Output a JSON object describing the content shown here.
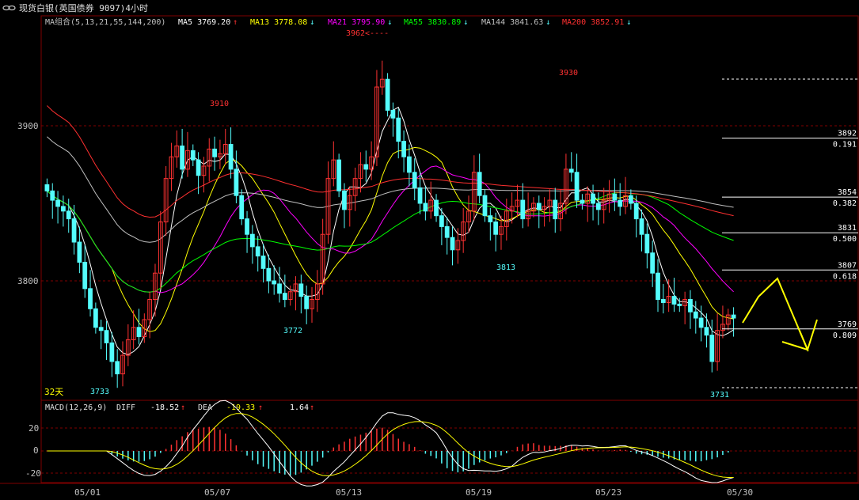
{
  "window": {
    "title": "现货白银(英国债券 9097)4小时",
    "icon": "chain-link-icon"
  },
  "ma_legend": {
    "label": "MA组合(5,13,21,55,144,200)",
    "items": [
      {
        "name": "MA5",
        "value": "3769.20",
        "arrow": "↑",
        "color": "#ffffff"
      },
      {
        "name": "MA13",
        "value": "3778.08",
        "arrow": "↓",
        "color": "#ffff00"
      },
      {
        "name": "MA21",
        "value": "3795.90",
        "arrow": "↓",
        "color": "#ff00ff"
      },
      {
        "name": "MA55",
        "value": "3830.89",
        "arrow": "↓",
        "color": "#00ff00"
      },
      {
        "name": "MA144",
        "value": "3841.63",
        "arrow": "↓",
        "color": "#c0c0c0"
      },
      {
        "name": "MA200",
        "value": "3852.91",
        "arrow": "↓",
        "color": "#ff3030"
      }
    ]
  },
  "price_axis": {
    "labels": [
      "3900",
      "3800"
    ]
  },
  "period_label": "32天",
  "annotations": {
    "highs": [
      "3962",
      "3930",
      "3910"
    ],
    "lows": [
      "3733",
      "3772",
      "3813",
      "3731"
    ],
    "high_arrow": "<----"
  },
  "fib_levels": [
    {
      "price": "3892",
      "ratio": "0.191"
    },
    {
      "price": "3854",
      "ratio": "0.382"
    },
    {
      "price": "3831",
      "ratio": "0.500"
    },
    {
      "price": "3807",
      "ratio": "0.618"
    },
    {
      "price": "3769",
      "ratio": "0.809"
    }
  ],
  "macd_legend": {
    "label": "MACD(12,26,9)",
    "diff_label": "DIFF",
    "diff_value": "-18.52",
    "diff_arrow": "↑",
    "dea_label": "DEA",
    "dea_value": "-19.33",
    "dea_arrow": "↑",
    "macd_value": "1.64",
    "macd_arrow": "↑"
  },
  "macd_axis": {
    "labels": [
      "20",
      "0",
      "-20"
    ]
  },
  "date_axis": {
    "labels": [
      "05/01",
      "05/07",
      "05/13",
      "05/19",
      "05/23",
      "05/30"
    ]
  },
  "colors": {
    "up": "#ff3232",
    "down": "#54fcfc",
    "grid": "#800000",
    "axis_text": "#c0c0c0",
    "projection": "#ffff00"
  },
  "chart_data": {
    "type": "candlestick",
    "timeframe": "4H",
    "price_axis_reference": [
      3800,
      3900
    ],
    "x": [
      "05/01",
      "05/07",
      "05/13",
      "05/19",
      "05/23",
      "05/30"
    ],
    "extremes": [
      {
        "label": "3733",
        "value": 3733,
        "kind": "low"
      },
      {
        "label": "3910",
        "value": 3910,
        "kind": "high"
      },
      {
        "label": "3772",
        "value": 3772,
        "kind": "low"
      },
      {
        "label": "3962",
        "value": 3962,
        "kind": "high"
      },
      {
        "label": "3813",
        "value": 3813,
        "kind": "low"
      },
      {
        "label": "3930",
        "value": 3930,
        "kind": "high"
      },
      {
        "label": "3731",
        "value": 3731,
        "kind": "low"
      }
    ],
    "closes": [
      3858,
      3852,
      3848,
      3845,
      3840,
      3825,
      3812,
      3795,
      3782,
      3770,
      3768,
      3760,
      3748,
      3740,
      3752,
      3762,
      3770,
      3764,
      3775,
      3788,
      3805,
      3838,
      3866,
      3880,
      3887,
      3872,
      3884,
      3878,
      3868,
      3874,
      3885,
      3880,
      3882,
      3888,
      3872,
      3855,
      3840,
      3830,
      3822,
      3816,
      3808,
      3800,
      3798,
      3792,
      3788,
      3793,
      3798,
      3790,
      3782,
      3788,
      3798,
      3830,
      3866,
      3878,
      3858,
      3846,
      3855,
      3866,
      3875,
      3872,
      3880,
      3925,
      3930,
      3910,
      3905,
      3890,
      3880,
      3870,
      3860,
      3850,
      3845,
      3852,
      3842,
      3835,
      3828,
      3820,
      3826,
      3838,
      3845,
      3870,
      3855,
      3842,
      3838,
      3830,
      3835,
      3845,
      3848,
      3852,
      3840,
      3845,
      3850,
      3846,
      3848,
      3852,
      3840,
      3850,
      3872,
      3870,
      3852,
      3850,
      3856,
      3850,
      3846,
      3852,
      3856,
      3852,
      3848,
      3855,
      3850,
      3840,
      3830,
      3818,
      3805,
      3788,
      3786,
      3790,
      3785,
      3784,
      3788,
      3780,
      3776,
      3770,
      3765,
      3748,
      3768,
      3772,
      3778,
      3776
    ],
    "ma_series": [
      {
        "name": "MA5",
        "color": "#ffffff",
        "last": 3769.2
      },
      {
        "name": "MA13",
        "color": "#ffff00",
        "last": 3778.08
      },
      {
        "name": "MA21",
        "color": "#ff00ff",
        "last": 3795.9
      },
      {
        "name": "MA55",
        "color": "#00ff00",
        "last": 3830.89
      },
      {
        "name": "MA144",
        "color": "#c0c0c0",
        "last": 3841.63
      },
      {
        "name": "MA200",
        "color": "#ff3030",
        "last": 3852.91
      }
    ],
    "fibonacci": [
      {
        "ratio": 0.191,
        "price": 3892
      },
      {
        "ratio": 0.382,
        "price": 3854
      },
      {
        "ratio": 0.5,
        "price": 3831
      },
      {
        "ratio": 0.618,
        "price": 3807
      },
      {
        "ratio": 0.809,
        "price": 3769
      }
    ],
    "projection_path": [
      3769,
      3807,
      3760
    ],
    "macd": {
      "diff": -18.52,
      "dea": -19.33,
      "macd": 1.64,
      "axis": [
        20,
        0,
        -20
      ]
    }
  }
}
